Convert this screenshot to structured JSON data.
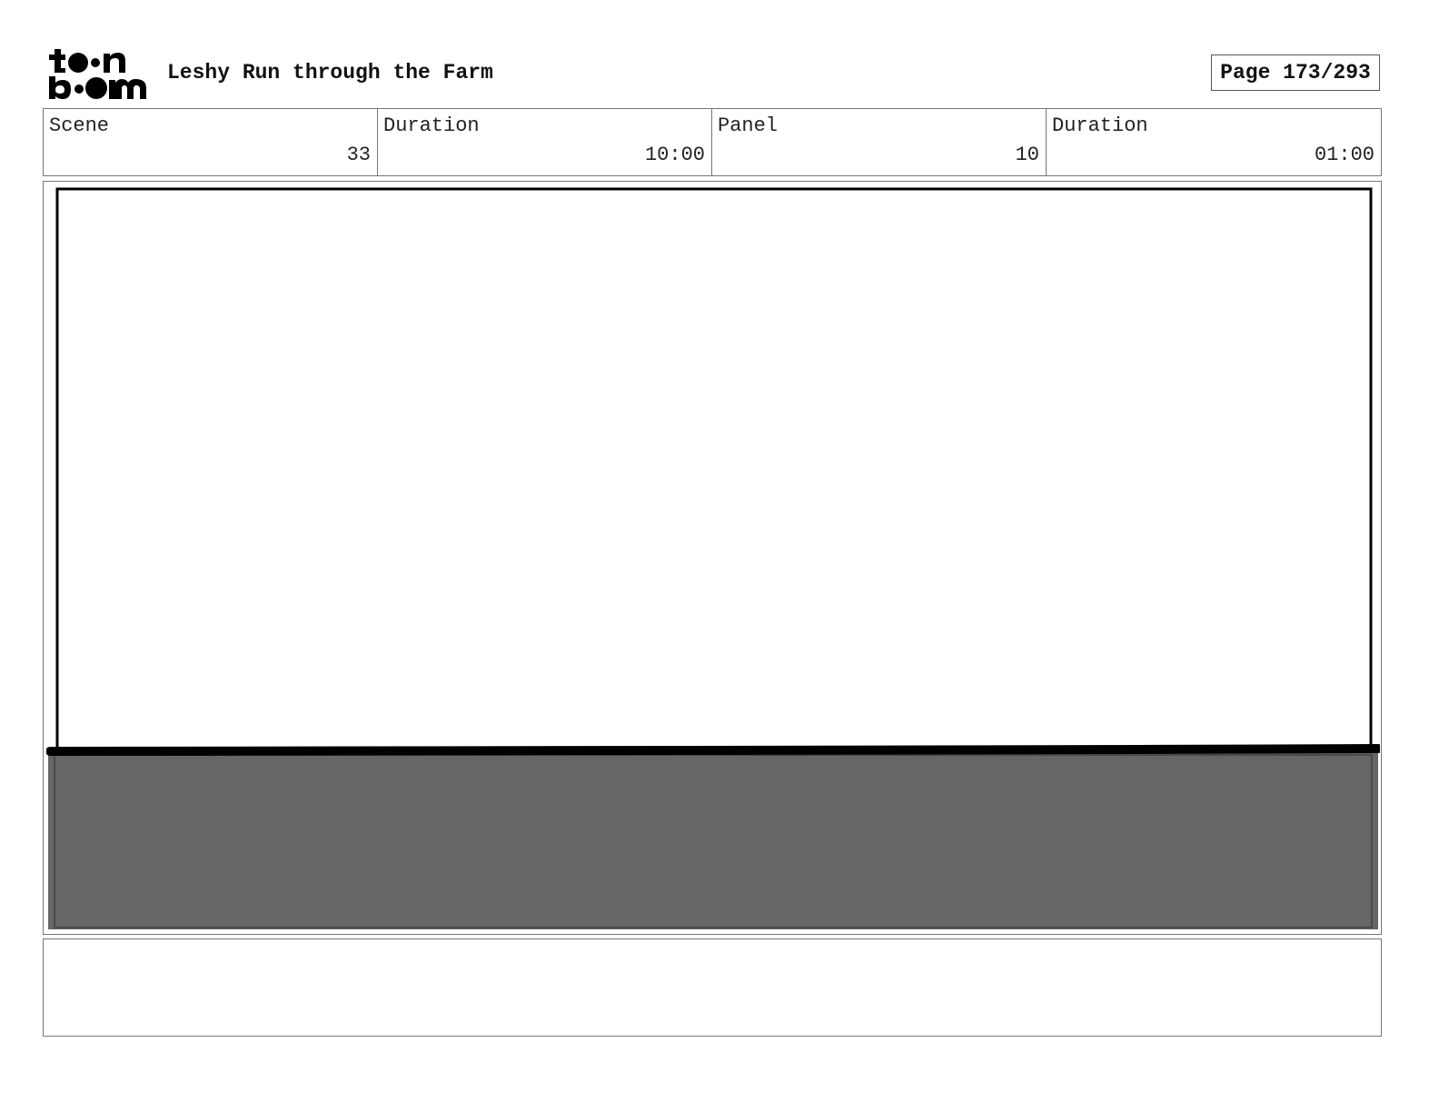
{
  "header": {
    "logo_icon": "toon-boom-logo-icon",
    "logo_text_top": "toon",
    "logo_text_bottom": "boom",
    "title": "Leshy Run through the Farm",
    "page_label": "Page 173/293"
  },
  "info": [
    {
      "label": "Scene",
      "value": "33"
    },
    {
      "label": "Duration",
      "value": "10:00"
    },
    {
      "label": "Panel",
      "value": "10"
    },
    {
      "label": "Duration",
      "value": "01:00"
    }
  ],
  "panel": {
    "sketch_colors": {
      "line": "#000000",
      "ground_fill": "#666666"
    }
  },
  "notes": {
    "text": ""
  }
}
